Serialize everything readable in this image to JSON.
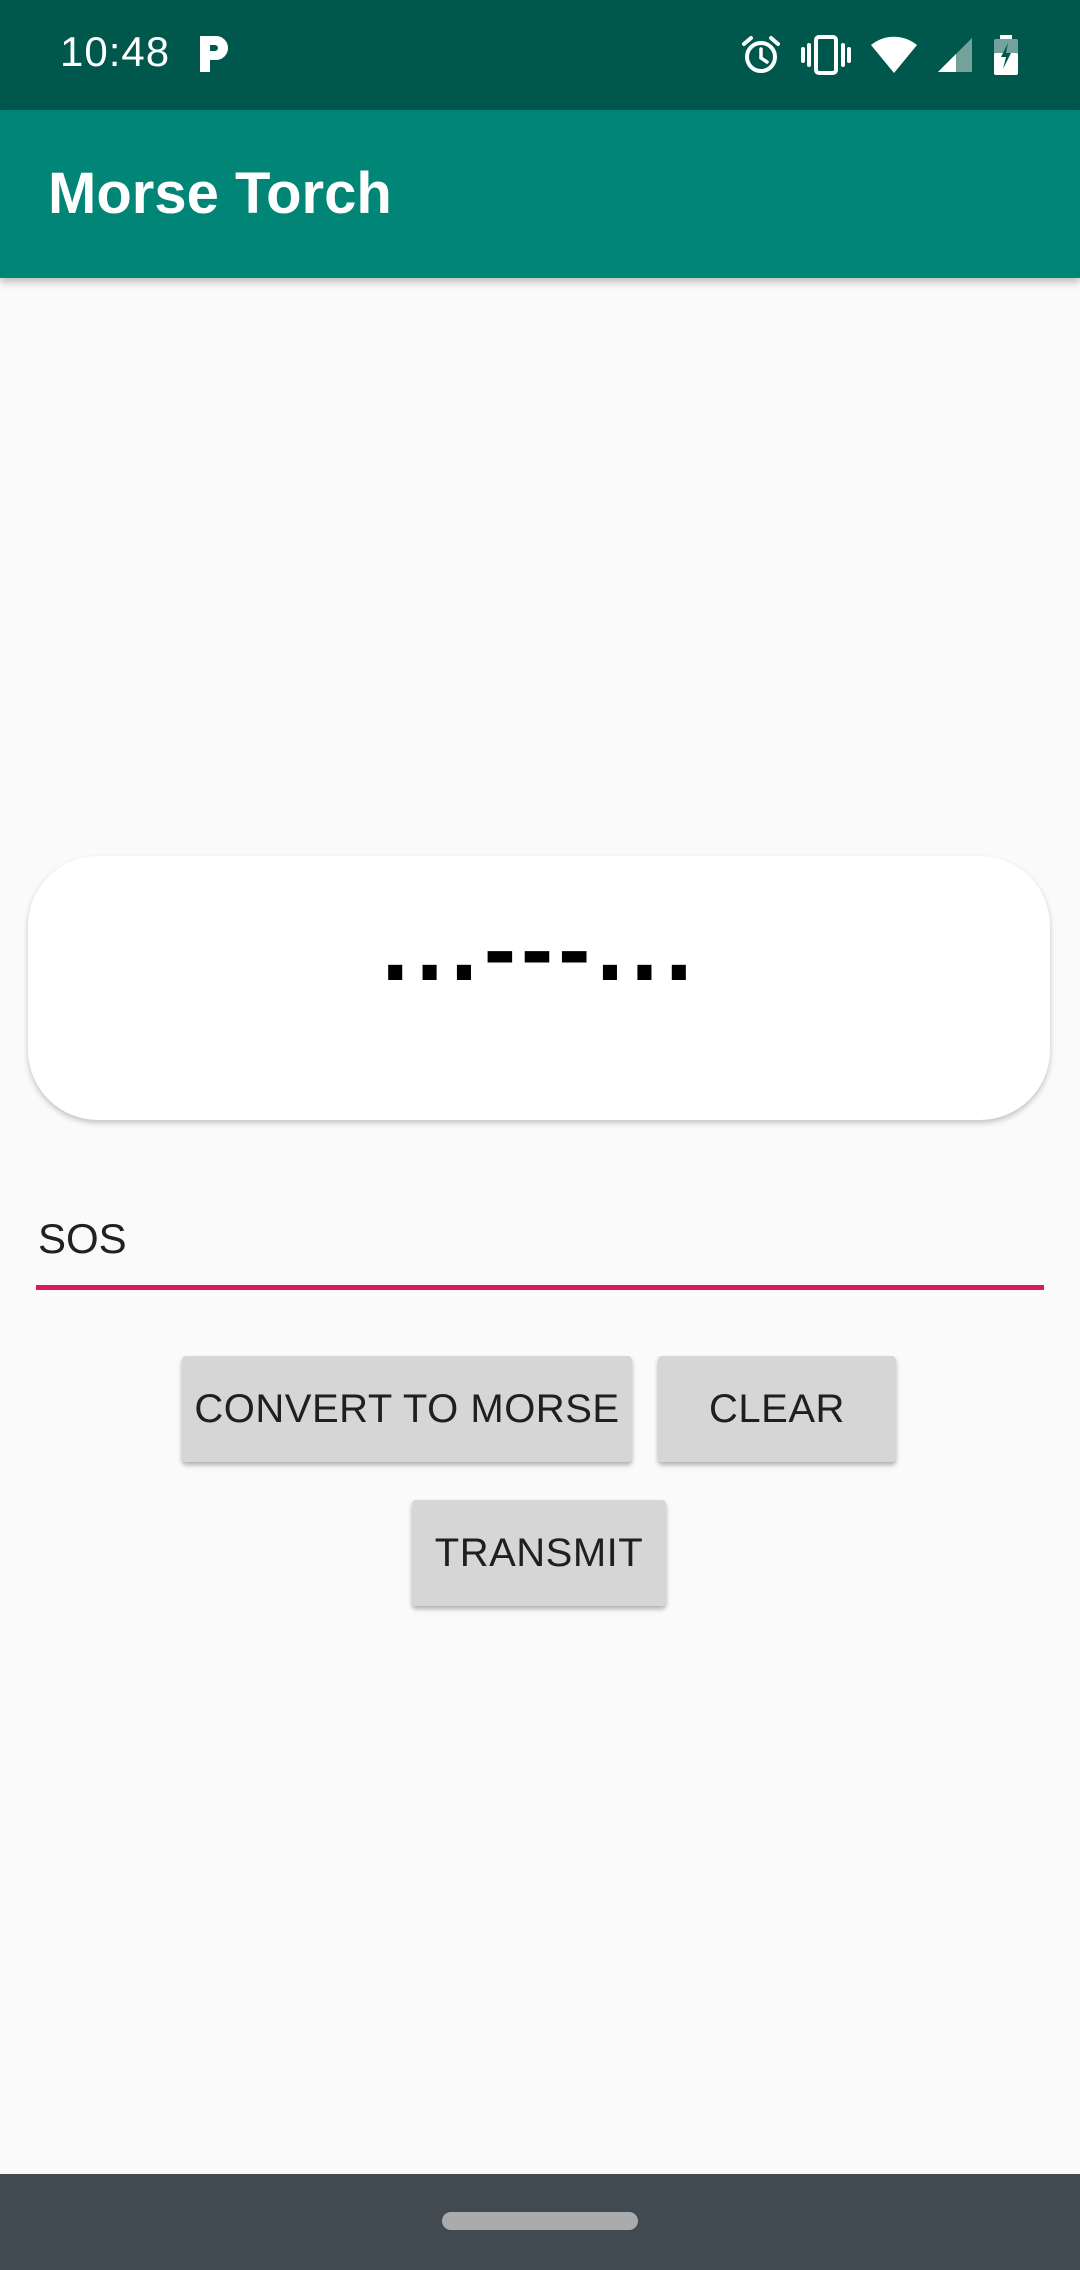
{
  "status_bar": {
    "time": "10:48",
    "icons": [
      "parking-icon",
      "alarm-icon",
      "vibrate-icon",
      "wifi-icon",
      "signal-icon",
      "battery-icon"
    ]
  },
  "app_bar": {
    "title": "Morse Torch"
  },
  "morse_display": {
    "code": "...---..."
  },
  "input": {
    "value": "SOS"
  },
  "buttons": {
    "convert_label": "CONVERT TO MORSE",
    "clear_label": "CLEAR",
    "transmit_label": "TRANSMIT"
  },
  "colors": {
    "status_bar": "#00574b",
    "app_bar": "#008577",
    "input_underline": "#d81b60",
    "button_bg": "#d6d6d6",
    "nav_bar": "#424a51"
  }
}
